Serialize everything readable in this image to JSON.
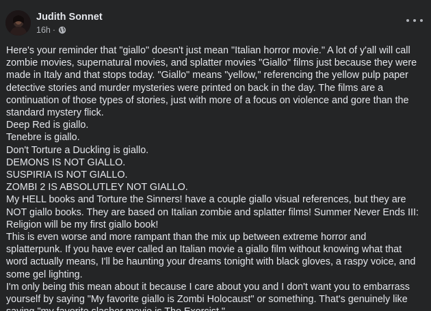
{
  "post": {
    "author": "Judith Sonnet",
    "timestamp": "16h",
    "separator": "·",
    "privacy_icon": "globe-icon",
    "more_icon": "more-options-icon",
    "paragraphs": [
      "Here's your reminder that \"giallo\" doesn't just mean \"Italian horror movie.\" A lot of y'all will call zombie movies, supernatural movies, and splatter movies \"Giallo\" films just because they were made in Italy and that stops today. \"Giallo\" means \"yellow,\" referencing the yellow pulp paper detective stories and murder mysteries were printed on back in the day. The films are a continuation of those types of stories, just with more of a focus on violence and gore than the standard mystery flick.",
      "Deep Red is giallo.",
      "Tenebre is giallo.",
      "Don't Torture a Duckling is giallo.",
      "DEMONS IS NOT GIALLO.",
      "SUSPIRIA IS NOT GIALLO.",
      "ZOMBI 2 IS ABSOLUTLEY NOT GIALLO.",
      "My HELL books and Torture the Sinners! have a couple giallo visual references, but they are NOT giallo books. They are based on Italian zombie and splatter films! Summer Never Ends III: Religion will be my first giallo book!",
      "This is even worse and more rampant than the mix up between extreme horror and splatterpunk. If you have ever called an Italian movie a giallo film without knowing what that word actually means, I'll be haunting your dreams tonight with black gloves, a raspy voice, and some gel lighting.",
      "I'm only being this mean about it because I care about you and I don't want you to embarrass yourself by saying \"My favorite giallo is Zombi Holocaust\" or something. That's genuinely like saying \"my favorite slasher movie is The Exorcist.\""
    ]
  },
  "colors": {
    "background": "#242526",
    "primary_text": "#e4e6eb",
    "secondary_text": "#b0b3b8"
  }
}
